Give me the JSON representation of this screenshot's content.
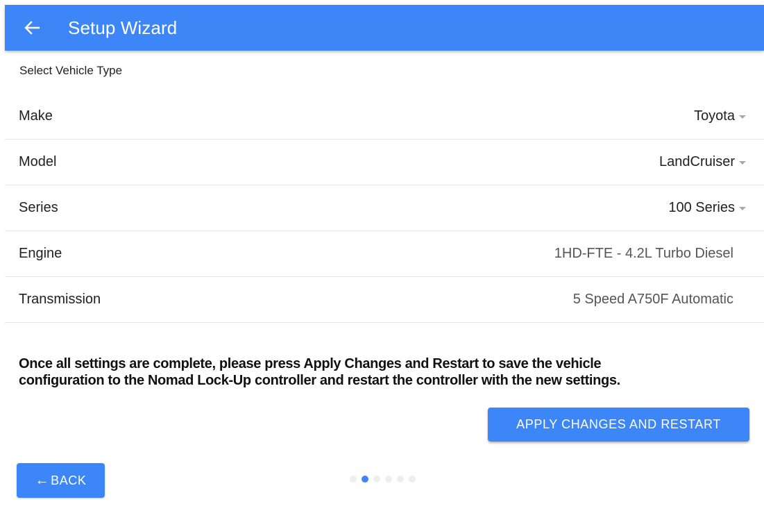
{
  "header": {
    "title": "Setup Wizard",
    "back_icon": "arrow-left-icon"
  },
  "section": {
    "label": "Select Vehicle Type"
  },
  "fields": {
    "make": {
      "label": "Make",
      "value": "Toyota"
    },
    "model": {
      "label": "Model",
      "value": "LandCruiser"
    },
    "series": {
      "label": "Series",
      "value": "100 Series"
    },
    "engine": {
      "label": "Engine",
      "value": "1HD-FTE - 4.2L Turbo Diesel"
    },
    "transmission": {
      "label": "Transmission",
      "value": "5 Speed A750F Automatic"
    }
  },
  "instructions": {
    "line1": "Once all settings are complete, please press Apply Changes and Restart to save the vehicle",
    "line2": "configuration to the Nomad Lock-Up controller and restart the controller with the new settings."
  },
  "actions": {
    "apply_label": "APPLY CHANGES AND RESTART",
    "back_label": "BACK",
    "back_arrow": "←"
  },
  "stepper": {
    "total_steps": 6,
    "current_step": 2
  },
  "colors": {
    "primary": "#3d86f7",
    "dot_inactive": "#eeeeee",
    "caret": "#a8a8a8"
  }
}
